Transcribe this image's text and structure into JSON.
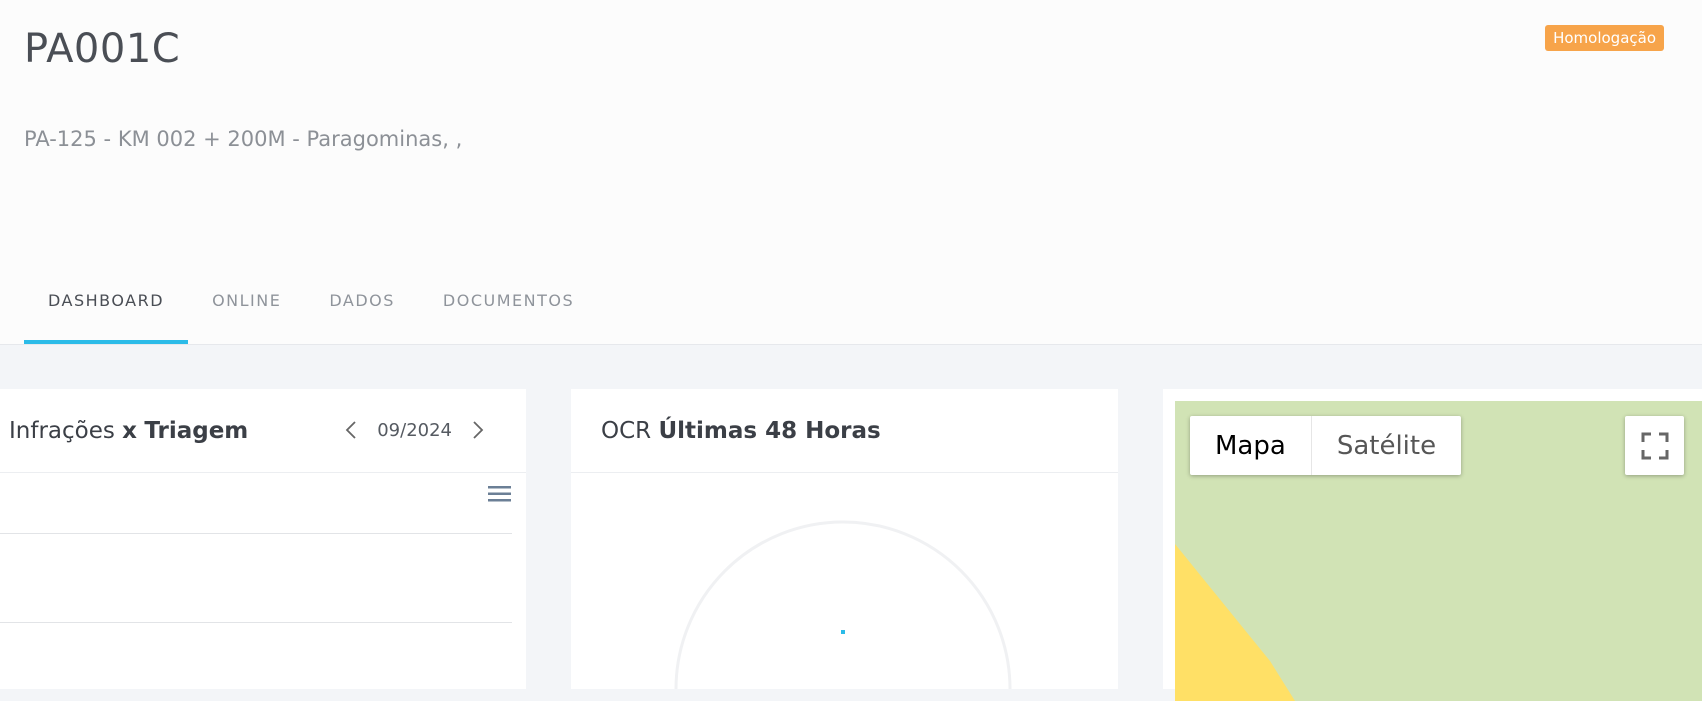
{
  "header": {
    "title": "PA001C",
    "subtitle": "PA-125 - KM 002 + 200M - Paragominas, ,",
    "badge": "Homologação"
  },
  "tabs": [
    {
      "label": "DASHBOARD",
      "active": true
    },
    {
      "label": "ONLINE",
      "active": false
    },
    {
      "label": "DADOS",
      "active": false
    },
    {
      "label": "DOCUMENTOS",
      "active": false
    }
  ],
  "infracoes_card": {
    "title_regular": "Infrações",
    "title_connector": "x",
    "title_bold": "Triagem",
    "month": "09/2024",
    "prev_icon": "chevron-left-icon",
    "next_icon": "chevron-right-icon",
    "menu_icon": "hamburger-menu-icon"
  },
  "ocr_card": {
    "title_regular": "OCR",
    "title_bold": "Últimas 48 Horas"
  },
  "map_card": {
    "map_type_options": [
      "Mapa",
      "Satélite"
    ],
    "selected": "Mapa",
    "fullscreen_icon": "fullscreen-icon"
  },
  "colors": {
    "accent": "#2bbbe8",
    "badge": "#f7a44a",
    "map_land": "#d1e3b5",
    "map_road": "#ffe066"
  }
}
